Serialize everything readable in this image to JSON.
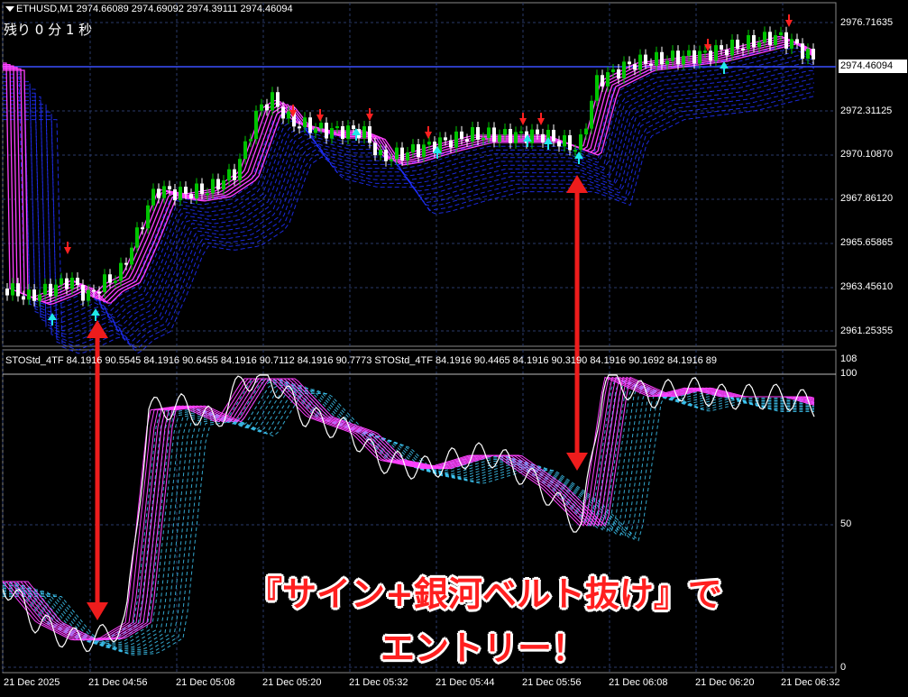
{
  "header": {
    "symbol_line": "ETHUSD,M1  2974.66089 2974.69092 2974.39111 2974.46094",
    "countdown": "残り  0  分  1  秒"
  },
  "price_axis": {
    "labels": [
      "2976.71635",
      "2974.46094",
      "2972.31125",
      "2970.10870",
      "2967.86120",
      "2965.65865",
      "2963.45610",
      "2961.25355"
    ],
    "current": "2974.46094"
  },
  "oscillator": {
    "header": "STOStd_4TF 84.1916 90.5545 84.1916 90.6455 84.1916 90.7112 84.1916 90.7773   STOStd_4TF 84.1916 90.4465 84.1916 90.3190 84.1916 90.1692 84.1916 89",
    "scale": [
      "108",
      "100",
      "50",
      "0"
    ]
  },
  "time_axis": [
    "21 Dec 2025",
    "21 Dec 04:56",
    "21 Dec 05:08",
    "21 Dec 05:20",
    "21 Dec 05:32",
    "21 Dec 05:44",
    "21 Dec 05:56",
    "21 Dec 06:08",
    "21 Dec 06:20",
    "21 Dec 06:32"
  ],
  "caption": {
    "line1": "『サイン+銀河ベルト抜け』で",
    "line2": "エントリー！"
  },
  "colors": {
    "bull": "#00c400",
    "bear": "#ffffff",
    "belt_top": "#ff40ff",
    "belt_low": "#2030ff",
    "osc_cyan": "#40d0ff",
    "arrow": "#ee1c1c",
    "sell_arrow": "#ff2020",
    "buy_arrow": "#20e8e8"
  }
}
